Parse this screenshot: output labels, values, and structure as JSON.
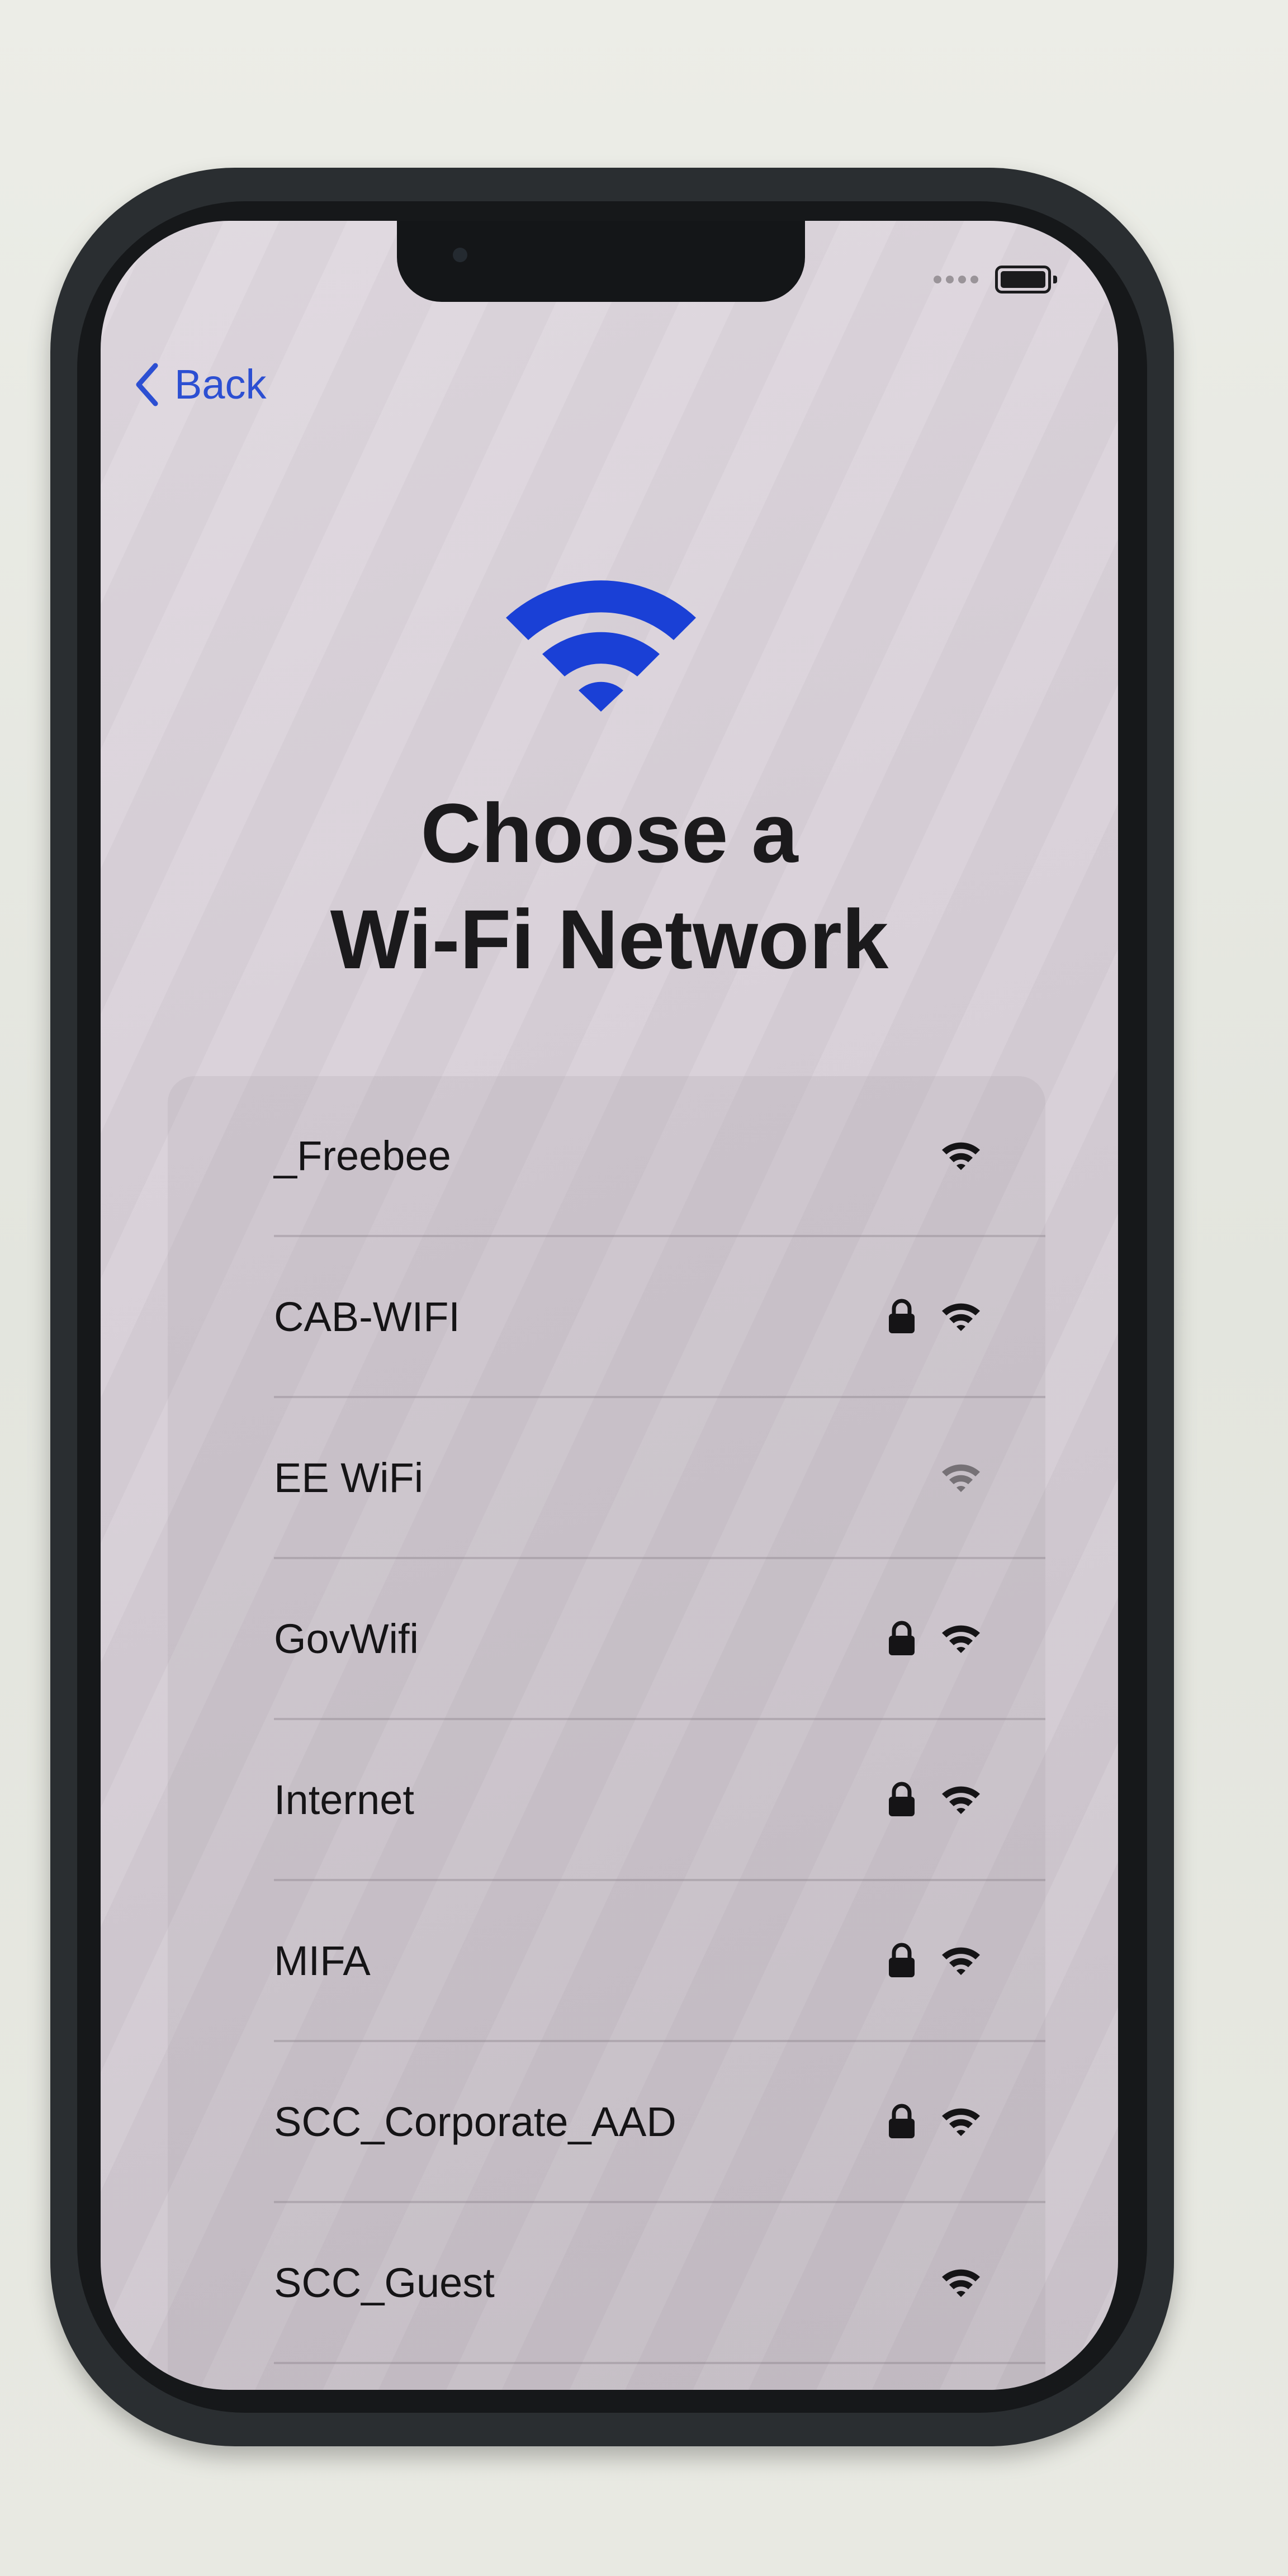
{
  "status_bar": {
    "signal": "signal-dots-icon",
    "battery": "battery-icon"
  },
  "navigation": {
    "back_label": "Back",
    "back_icon": "chevron-left-icon"
  },
  "hero": {
    "icon": "wifi-icon",
    "color": "#1a40d6",
    "title_line1": "Choose a",
    "title_line2": "Wi-Fi Network"
  },
  "colors": {
    "accent": "#2c4fd2"
  },
  "networks": [
    {
      "name": "_Freebee",
      "locked": false,
      "signal": "strong"
    },
    {
      "name": "CAB-WIFI",
      "locked": true,
      "signal": "strong"
    },
    {
      "name": "EE WiFi",
      "locked": false,
      "signal": "weak"
    },
    {
      "name": "GovWifi",
      "locked": true,
      "signal": "strong"
    },
    {
      "name": "Internet",
      "locked": true,
      "signal": "strong"
    },
    {
      "name": "MIFA",
      "locked": true,
      "signal": "strong"
    },
    {
      "name": "SCC_Corporate_AAD",
      "locked": true,
      "signal": "strong"
    },
    {
      "name": "SCC_Guest",
      "locked": false,
      "signal": "strong"
    }
  ]
}
